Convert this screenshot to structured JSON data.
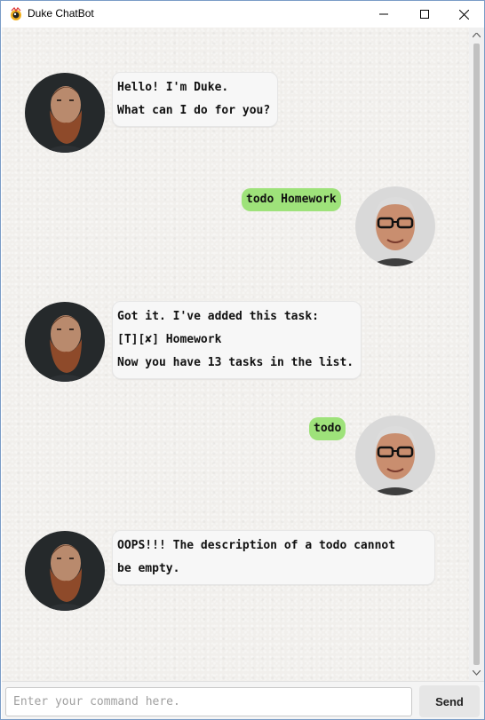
{
  "window": {
    "title": "Duke ChatBot"
  },
  "messages": [
    {
      "from": "duke",
      "lines": [
        "Hello! I'm Duke.",
        "What can I do for you?"
      ]
    },
    {
      "from": "user",
      "lines": [
        "todo Homework"
      ]
    },
    {
      "from": "duke",
      "lines": [
        "Got it. I've added this task:",
        "[T][✘] Homework",
        "Now you have 13 tasks in the list."
      ]
    },
    {
      "from": "user",
      "lines": [
        "todo"
      ]
    },
    {
      "from": "duke",
      "lines": [
        "OOPS!!! The description of a todo cannot",
        "be empty."
      ]
    }
  ],
  "input": {
    "placeholder": "Enter your command here.",
    "value": ""
  },
  "send_button": {
    "label": "Send"
  },
  "icons": {
    "app": "duke-logo-icon",
    "minimize": "minimize-icon",
    "maximize": "maximize-icon",
    "close": "close-icon"
  },
  "colors": {
    "user_bubble": "#9ee27a",
    "duke_bubble": "#f7f7f7",
    "chat_background": "#f1efec"
  }
}
